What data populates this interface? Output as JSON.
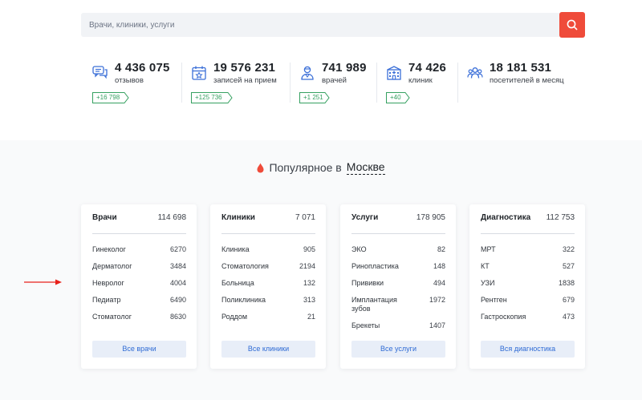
{
  "search": {
    "placeholder": "Врачи, клиники, услуги"
  },
  "stats": [
    {
      "icon": "reviews-icon",
      "value": "4 436 075",
      "label": "отзывов",
      "delta": "+16 798"
    },
    {
      "icon": "calendar-icon",
      "value": "19 576 231",
      "label": "записей на прием",
      "delta": "+125 736"
    },
    {
      "icon": "doctor-icon",
      "value": "741 989",
      "label": "врачей",
      "delta": "+1 251"
    },
    {
      "icon": "clinic-icon",
      "value": "74 426",
      "label": "клиник",
      "delta": "+40"
    },
    {
      "icon": "visitors-icon",
      "value": "18 181 531",
      "label": "посетителей в месяц",
      "delta": ""
    }
  ],
  "popular": {
    "prefix": "Популярное в",
    "city": "Москве"
  },
  "cards": [
    {
      "title": "Врачи",
      "count": "114 698",
      "rows": [
        {
          "name": "Гинеколог",
          "count": "6270"
        },
        {
          "name": "Дерматолог",
          "count": "3484"
        },
        {
          "name": "Невролог",
          "count": "4004"
        },
        {
          "name": "Педиатр",
          "count": "6490"
        },
        {
          "name": "Стоматолог",
          "count": "8630"
        }
      ],
      "button": "Все врачи"
    },
    {
      "title": "Клиники",
      "count": "7 071",
      "rows": [
        {
          "name": "Клиника",
          "count": "905"
        },
        {
          "name": "Стоматология",
          "count": "2194"
        },
        {
          "name": "Больница",
          "count": "132"
        },
        {
          "name": "Поликлиника",
          "count": "313"
        },
        {
          "name": "Роддом",
          "count": "21"
        }
      ],
      "button": "Все клиники"
    },
    {
      "title": "Услуги",
      "count": "178 905",
      "rows": [
        {
          "name": "ЭКО",
          "count": "82"
        },
        {
          "name": "Ринопластика",
          "count": "148"
        },
        {
          "name": "Прививки",
          "count": "494"
        },
        {
          "name": "Имплантация\nзубов",
          "count": "1972"
        },
        {
          "name": "Брекеты",
          "count": "1407"
        }
      ],
      "button": "Все услуги"
    },
    {
      "title": "Диагностика",
      "count": "112 753",
      "rows": [
        {
          "name": "МРТ",
          "count": "322"
        },
        {
          "name": "КТ",
          "count": "527"
        },
        {
          "name": "УЗИ",
          "count": "1838"
        },
        {
          "name": "Рентген",
          "count": "679"
        },
        {
          "name": "Гастроскопия",
          "count": "473"
        }
      ],
      "button": "Вся диагностика"
    }
  ],
  "colors": {
    "accent": "#ef4b3a",
    "delta": "#35a060",
    "link": "#2f6bd4",
    "icon": "#3b6fd8"
  }
}
